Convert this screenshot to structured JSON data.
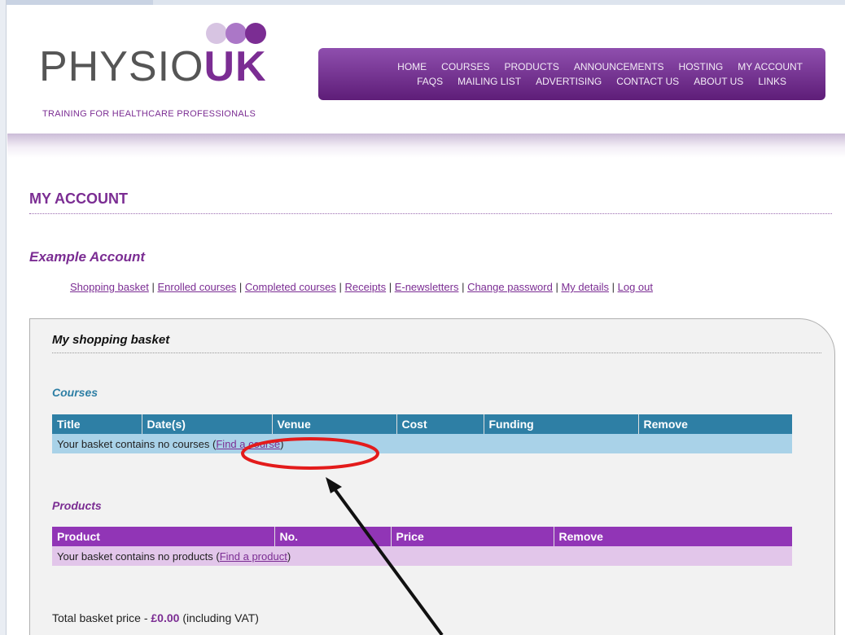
{
  "colors": {
    "brand_purple": "#7b2d93",
    "courses_header": "#2e7fa5",
    "courses_row": "#a9d2e8",
    "courses_label": "#2e7fa5",
    "products_header": "#9135b6",
    "products_row": "#e2c6ea",
    "annotation_red": "#e31b1b"
  },
  "logo": {
    "text_light": "PHYSIO",
    "text_bold": "UK",
    "tagline": "TRAINING FOR HEALTHCARE PROFESSIONALS",
    "dot_colors": [
      "#d7c4e2",
      "#ab77c7",
      "#7b2d93"
    ]
  },
  "topnav": {
    "row1": [
      "HOME",
      "COURSES",
      "PRODUCTS",
      "ANNOUNCEMENTS",
      "HOSTING",
      "MY ACCOUNT"
    ],
    "row2": [
      "FAQS",
      "MAILING LIST",
      "ADVERTISING",
      "CONTACT US",
      "ABOUT US",
      "LINKS"
    ]
  },
  "page": {
    "title": "MY ACCOUNT",
    "account_name": "Example Account"
  },
  "account_links": {
    "items": [
      "Shopping basket",
      "Enrolled courses",
      "Completed courses",
      "Receipts",
      "E-newsletters",
      "Change password",
      "My details",
      "Log out"
    ],
    "separator": " | "
  },
  "basket": {
    "title": "My shopping basket",
    "courses": {
      "label": "Courses",
      "headers": [
        "Title",
        "Date(s)",
        "Venue",
        "Cost",
        "Funding",
        "Remove"
      ],
      "empty_prefix": "Your basket contains no courses (",
      "empty_link": "Find a course",
      "empty_suffix": ")"
    },
    "products": {
      "label": "Products",
      "headers": [
        "Product",
        "No.",
        "Price",
        "Remove"
      ],
      "empty_prefix": "Your basket contains no products (",
      "empty_link": "Find a product",
      "empty_suffix": ")"
    },
    "total": {
      "prefix": "Total basket price - ",
      "amount": "£0.00",
      "suffix": " (including VAT)"
    }
  }
}
